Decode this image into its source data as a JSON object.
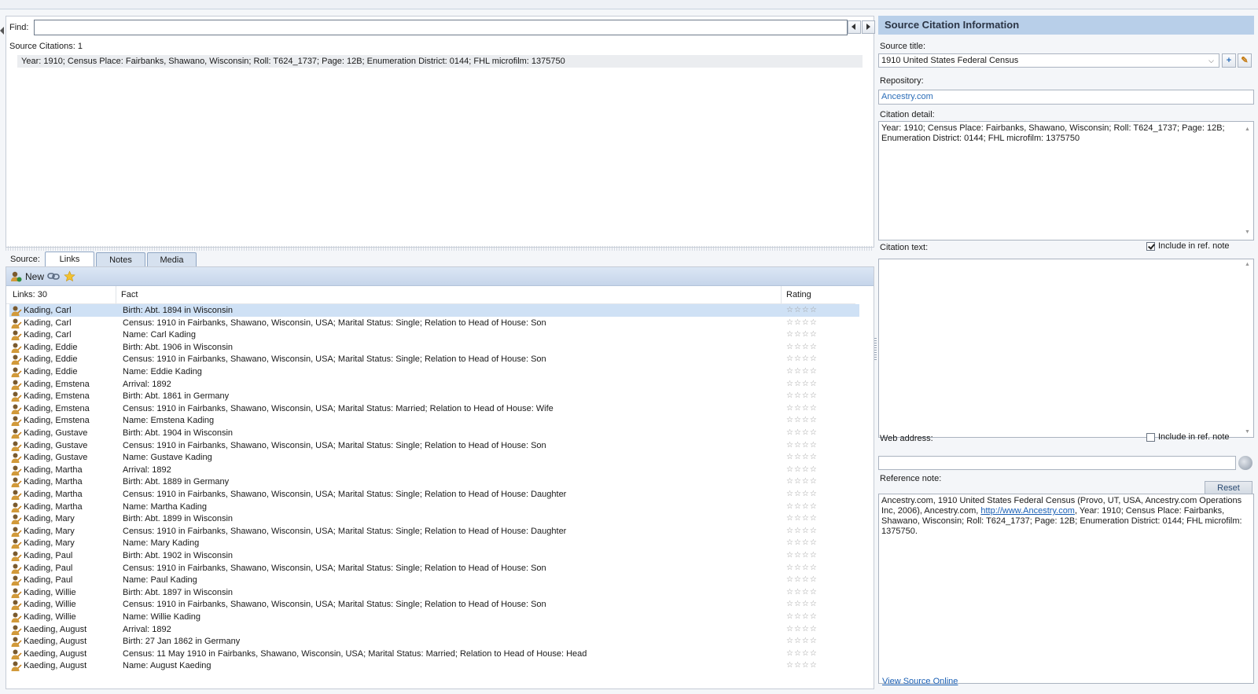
{
  "find": {
    "label": "Find:",
    "value": ""
  },
  "citations": {
    "count_label": "Source Citations: 1",
    "items": [
      "Year: 1910; Census Place: Fairbanks, Shawano, Wisconsin; Roll: T624_1737; Page: 12B; Enumeration District: 0144; FHL microfilm: 1375750"
    ]
  },
  "tabs": {
    "source_label": "Source:",
    "items": [
      "Links",
      "Notes",
      "Media"
    ],
    "active": "Links"
  },
  "toolbar": {
    "new_label": "New"
  },
  "grid": {
    "count_label": "Links: 30",
    "columns": [
      "Fact",
      "Rating"
    ],
    "rating_display": "☆☆☆☆",
    "rows": [
      {
        "name": "Kading, Carl",
        "fact": "Birth: Abt. 1894 in Wisconsin"
      },
      {
        "name": "Kading, Carl",
        "fact": "Census: 1910 in Fairbanks, Shawano, Wisconsin, USA; Marital Status: Single; Relation to Head of House: Son"
      },
      {
        "name": "Kading, Carl",
        "fact": "Name: Carl Kading"
      },
      {
        "name": "Kading, Eddie",
        "fact": "Birth: Abt. 1906 in Wisconsin"
      },
      {
        "name": "Kading, Eddie",
        "fact": "Census: 1910 in Fairbanks, Shawano, Wisconsin, USA; Marital Status: Single; Relation to Head of House: Son"
      },
      {
        "name": "Kading, Eddie",
        "fact": "Name: Eddie Kading"
      },
      {
        "name": "Kading, Emstena",
        "fact": "Arrival: 1892"
      },
      {
        "name": "Kading, Emstena",
        "fact": "Birth: Abt. 1861 in Germany"
      },
      {
        "name": "Kading, Emstena",
        "fact": "Census: 1910 in Fairbanks, Shawano, Wisconsin, USA; Marital Status: Married; Relation to Head of House: Wife"
      },
      {
        "name": "Kading, Emstena",
        "fact": "Name: Emstena Kading"
      },
      {
        "name": "Kading, Gustave",
        "fact": "Birth: Abt. 1904 in Wisconsin"
      },
      {
        "name": "Kading, Gustave",
        "fact": "Census: 1910 in Fairbanks, Shawano, Wisconsin, USA; Marital Status: Single; Relation to Head of House: Son"
      },
      {
        "name": "Kading, Gustave",
        "fact": "Name: Gustave Kading"
      },
      {
        "name": "Kading, Martha",
        "fact": "Arrival: 1892"
      },
      {
        "name": "Kading, Martha",
        "fact": "Birth: Abt. 1889 in Germany"
      },
      {
        "name": "Kading, Martha",
        "fact": "Census: 1910 in Fairbanks, Shawano, Wisconsin, USA; Marital Status: Single; Relation to Head of House: Daughter"
      },
      {
        "name": "Kading, Martha",
        "fact": "Name: Martha Kading"
      },
      {
        "name": "Kading, Mary",
        "fact": "Birth: Abt. 1899 in Wisconsin"
      },
      {
        "name": "Kading, Mary",
        "fact": "Census: 1910 in Fairbanks, Shawano, Wisconsin, USA; Marital Status: Single; Relation to Head of House: Daughter"
      },
      {
        "name": "Kading, Mary",
        "fact": "Name: Mary Kading"
      },
      {
        "name": "Kading, Paul",
        "fact": "Birth: Abt. 1902 in Wisconsin"
      },
      {
        "name": "Kading, Paul",
        "fact": "Census: 1910 in Fairbanks, Shawano, Wisconsin, USA; Marital Status: Single; Relation to Head of House: Son"
      },
      {
        "name": "Kading, Paul",
        "fact": "Name: Paul Kading"
      },
      {
        "name": "Kading, Willie",
        "fact": "Birth: Abt. 1897 in Wisconsin"
      },
      {
        "name": "Kading, Willie",
        "fact": "Census: 1910 in Fairbanks, Shawano, Wisconsin, USA; Marital Status: Single; Relation to Head of House: Son"
      },
      {
        "name": "Kading, Willie",
        "fact": "Name: Willie Kading"
      },
      {
        "name": "Kaeding, August",
        "fact": "Arrival: 1892"
      },
      {
        "name": "Kaeding, August",
        "fact": "Birth: 27 Jan 1862 in Germany"
      },
      {
        "name": "Kaeding, August",
        "fact": "Census: 11 May 1910 in Fairbanks, Shawano, Wisconsin, USA; Marital Status: Married; Relation to Head of House: Head"
      },
      {
        "name": "Kaeding, August",
        "fact": "Name: August Kaeding"
      }
    ]
  },
  "panel": {
    "title": "Source Citation Information",
    "source_title_label": "Source title:",
    "source_title_value": "1910 United States Federal Census",
    "repository_label": "Repository:",
    "repository_value": "Ancestry.com",
    "citation_detail_label": "Citation detail:",
    "citation_detail_value": "Year: 1910; Census Place: Fairbanks, Shawano, Wisconsin; Roll: T624_1737; Page: 12B; Enumeration District: 0144; FHL microfilm: 1375750",
    "citation_text_label": "Citation text:",
    "include_label": "Include in ref. note",
    "include_citation_checked": true,
    "web_address_label": "Web address:",
    "include_web_checked": false,
    "web_address_value": "",
    "reset_label": "Reset",
    "reference_note_label": "Reference note:",
    "reference_note_pre": "Ancestry.com, 1910 United States Federal Census (Provo, UT, USA, Ancestry.com Operations Inc, 2006), Ancestry.com, ",
    "reference_note_link": "http://www.Ancestry.com",
    "reference_note_post": ", Year: 1910; Census Place: Fairbanks, Shawano, Wisconsin; Roll: T624_1737; Page: 12B; Enumeration District: 0144; FHL microfilm: 1375750.",
    "view_source_label": "View Source Online"
  },
  "colors": {
    "panel_header": "#b8cfe9",
    "selection": "#cfe1f5",
    "link": "#1a5fb4"
  }
}
